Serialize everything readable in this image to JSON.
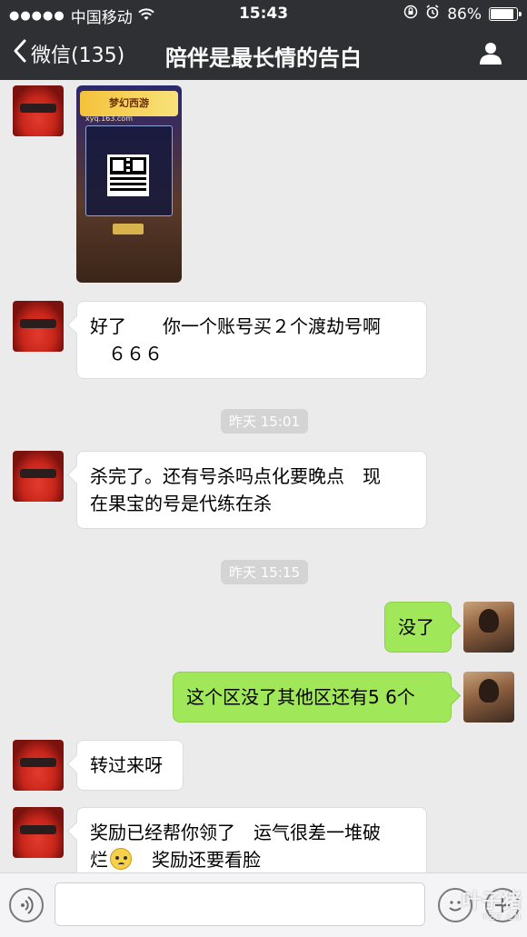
{
  "status_bar": {
    "carrier": "中国移动",
    "signal_dots": "●●●●●",
    "time": "15:43",
    "battery": "86%"
  },
  "nav": {
    "back_label": "微信(135)",
    "title": "陪伴是最长情的告白"
  },
  "messages": [
    {
      "side": "left",
      "type": "image",
      "image_text": {
        "logo": "梦幻西游",
        "url": "xyq.163.com"
      }
    },
    {
      "side": "left",
      "type": "text",
      "lines": [
        "好了　　你一个账号买２个渡劫号啊",
        "　６６６"
      ]
    },
    {
      "type": "time",
      "text": "昨天 15:01"
    },
    {
      "side": "left",
      "type": "text",
      "lines": [
        "杀完了。还有号杀吗点化要晚点　现",
        "在果宝的号是代练在杀"
      ]
    },
    {
      "type": "time",
      "text": "昨天 15:15"
    },
    {
      "side": "right",
      "type": "text",
      "text": "没了"
    },
    {
      "side": "right",
      "type": "text",
      "text": "这个区没了其他区还有5 6个"
    },
    {
      "side": "left",
      "type": "text",
      "text": "转过来呀"
    },
    {
      "side": "left",
      "type": "text",
      "lines": [
        "奖励已经帮你领了　运气很差一堆破",
        "烂",
        "　奖励还要看脸"
      ]
    }
  ],
  "watermark": {
    "main": "叶子猪",
    "sub": "YZZ.CN"
  },
  "colors": {
    "header": "#2f3034",
    "bubble_right": "#a0e75a",
    "background": "#ebebeb"
  }
}
